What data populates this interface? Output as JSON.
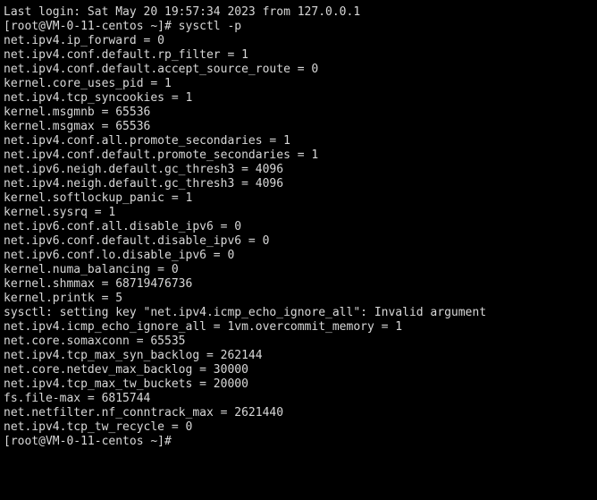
{
  "terminal": {
    "title": "root@VM-0-11-centos:~",
    "colors": {
      "background": "#000000",
      "foreground": "#d8d8d8"
    },
    "hostname": "VM-0-11-centos",
    "user": "root",
    "prompt": "[root@VM-0-11-centos ~]#",
    "login_banner": "Last login: Sat May 20 19:57:34 2023 from 127.0.0.1",
    "command": "sysctl -p",
    "lines": [
      "Last login: Sat May 20 19:57:34 2023 from 127.0.0.1",
      "[root@VM-0-11-centos ~]# sysctl -p",
      "net.ipv4.ip_forward = 0",
      "net.ipv4.conf.default.rp_filter = 1",
      "net.ipv4.conf.default.accept_source_route = 0",
      "kernel.core_uses_pid = 1",
      "net.ipv4.tcp_syncookies = 1",
      "kernel.msgmnb = 65536",
      "kernel.msgmax = 65536",
      "net.ipv4.conf.all.promote_secondaries = 1",
      "net.ipv4.conf.default.promote_secondaries = 1",
      "net.ipv6.neigh.default.gc_thresh3 = 4096",
      "net.ipv4.neigh.default.gc_thresh3 = 4096",
      "kernel.softlockup_panic = 1",
      "kernel.sysrq = 1",
      "net.ipv6.conf.all.disable_ipv6 = 0",
      "net.ipv6.conf.default.disable_ipv6 = 0",
      "net.ipv6.conf.lo.disable_ipv6 = 0",
      "kernel.numa_balancing = 0",
      "kernel.shmmax = 68719476736",
      "kernel.printk = 5",
      "sysctl: setting key \"net.ipv4.icmp_echo_ignore_all\": Invalid argument",
      "net.ipv4.icmp_echo_ignore_all = 1vm.overcommit_memory = 1",
      "net.core.somaxconn = 65535",
      "net.ipv4.tcp_max_syn_backlog = 262144",
      "net.core.netdev_max_backlog = 30000",
      "net.ipv4.tcp_max_tw_buckets = 20000",
      "fs.file-max = 6815744",
      "net.netfilter.nf_conntrack_max = 2621440",
      "net.ipv4.tcp_tw_recycle = 0",
      "[root@VM-0-11-centos ~]#"
    ]
  }
}
